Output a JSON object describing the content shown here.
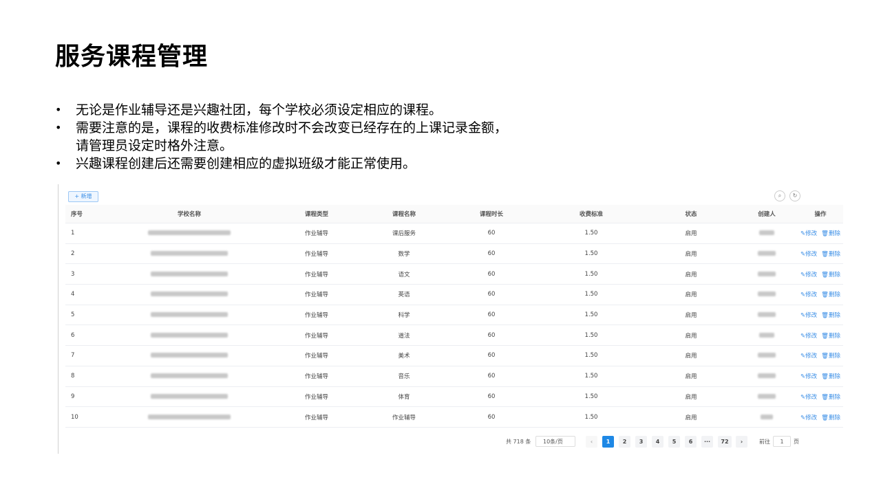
{
  "title": "服务课程管理",
  "bullets": {
    "b1": "无论是作业辅导还是兴趣社团，每个学校必须设定相应的课程。",
    "b2_line1": "需要注意的是，课程的收费标准修改时不会改变已经存在的上课记录金额，",
    "b2_line2": "请管理员设定时格外注意。",
    "b3": "兴趣课程创建后还需要创建相应的虚拟班级才能正常使用。"
  },
  "toolbar": {
    "add_label": "+ 新增",
    "search_icon": "search-icon",
    "refresh_icon": "refresh-icon"
  },
  "table": {
    "headers": [
      "序号",
      "学校名称",
      "课程类型",
      "课程名称",
      "课程时长",
      "收费标准",
      "状态",
      "创建人",
      "操作"
    ],
    "rows": [
      {
        "no": "1",
        "type": "作业辅导",
        "name": "课后服务",
        "duration": "60",
        "fee": "1.50",
        "status": "启用"
      },
      {
        "no": "2",
        "type": "作业辅导",
        "name": "数学",
        "duration": "60",
        "fee": "1.50",
        "status": "启用"
      },
      {
        "no": "3",
        "type": "作业辅导",
        "name": "语文",
        "duration": "60",
        "fee": "1.50",
        "status": "启用"
      },
      {
        "no": "4",
        "type": "作业辅导",
        "name": "英语",
        "duration": "60",
        "fee": "1.50",
        "status": "启用"
      },
      {
        "no": "5",
        "type": "作业辅导",
        "name": "科学",
        "duration": "60",
        "fee": "1.50",
        "status": "启用"
      },
      {
        "no": "6",
        "type": "作业辅导",
        "name": "道法",
        "duration": "60",
        "fee": "1.50",
        "status": "启用"
      },
      {
        "no": "7",
        "type": "作业辅导",
        "name": "美术",
        "duration": "60",
        "fee": "1.50",
        "status": "启用"
      },
      {
        "no": "8",
        "type": "作业辅导",
        "name": "音乐",
        "duration": "60",
        "fee": "1.50",
        "status": "启用"
      },
      {
        "no": "9",
        "type": "作业辅导",
        "name": "体育",
        "duration": "60",
        "fee": "1.50",
        "status": "启用"
      },
      {
        "no": "10",
        "type": "作业辅导",
        "name": "作业辅导",
        "duration": "60",
        "fee": "1.50",
        "status": "启用"
      }
    ],
    "edit_label": "✎修改",
    "delete_label": "🗑删除"
  },
  "pager": {
    "total": "共 718 条",
    "page_size": "10条/页",
    "prev": "‹",
    "pages": [
      "1",
      "2",
      "3",
      "4",
      "5",
      "6",
      "···",
      "72"
    ],
    "next": "›",
    "goto_label": "前往",
    "goto_value": "1",
    "page_unit": "页"
  }
}
